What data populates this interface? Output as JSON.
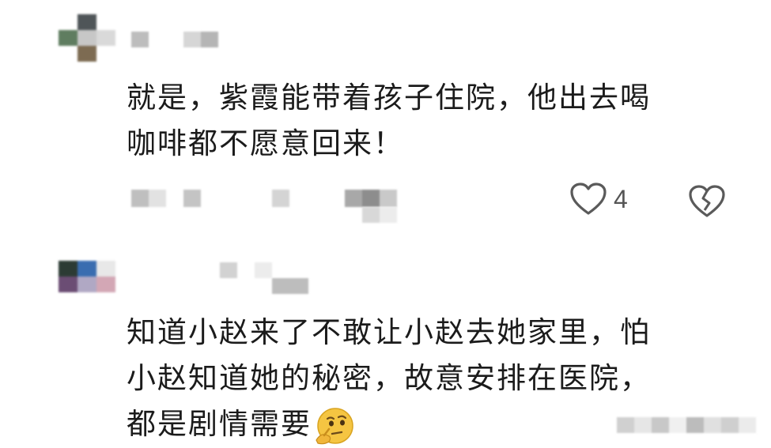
{
  "comments": [
    {
      "text_line1": "就是，紫霞能带着孩子住院，他出去喝",
      "text_line2": "咖啡都不愿意回来！",
      "like_count": "4",
      "icons": {
        "like": "heart-outline-icon",
        "dislike": "broken-heart-icon"
      }
    },
    {
      "text_line1": "知道小赵来了不敢让小赵去她家里，怕",
      "text_line2": "小赵知道她的秘密，故意安排在医院，",
      "text_line3": "都是剧情需要",
      "emoji": "thinking-face-emoji"
    }
  ],
  "colors": {
    "text": "#1b1b1b",
    "icon": "#5a5a5a",
    "emoji_yellow": "#f5c542"
  }
}
